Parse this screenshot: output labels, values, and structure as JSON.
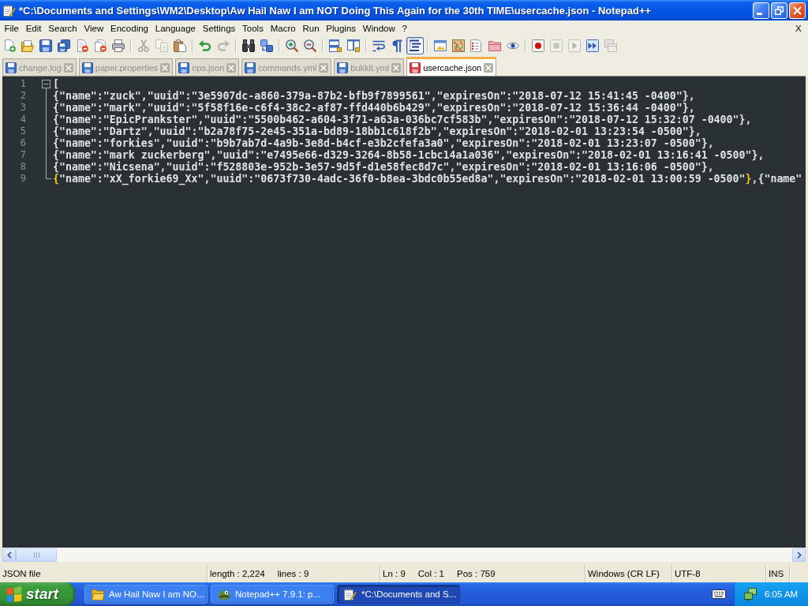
{
  "window": {
    "title": "*C:\\Documents and Settings\\WM2\\Desktop\\Aw Hail Naw I am NOT Doing This Again for the 30th TIME\\usercache.json - Notepad++"
  },
  "menu": {
    "items": [
      "File",
      "Edit",
      "Search",
      "View",
      "Encoding",
      "Language",
      "Settings",
      "Tools",
      "Macro",
      "Run",
      "Plugins",
      "Window",
      "?"
    ],
    "close_label": "X"
  },
  "toolbar": [
    [
      {
        "kind": "new",
        "disabled": false,
        "pressed": false
      },
      {
        "kind": "open",
        "disabled": false,
        "pressed": false
      },
      {
        "kind": "save",
        "disabled": false,
        "pressed": false
      },
      {
        "kind": "saveall",
        "disabled": false,
        "pressed": false
      },
      {
        "kind": "close",
        "disabled": false,
        "pressed": false
      },
      {
        "kind": "closeall",
        "disabled": false,
        "pressed": false
      },
      {
        "kind": "print",
        "disabled": false,
        "pressed": false
      }
    ],
    [
      {
        "kind": "cut",
        "disabled": true,
        "pressed": false
      },
      {
        "kind": "copy",
        "disabled": true,
        "pressed": false
      },
      {
        "kind": "paste",
        "disabled": false,
        "pressed": false
      }
    ],
    [
      {
        "kind": "undo",
        "disabled": false,
        "pressed": false
      },
      {
        "kind": "redo",
        "disabled": true,
        "pressed": false
      }
    ],
    [
      {
        "kind": "find",
        "disabled": false,
        "pressed": false
      },
      {
        "kind": "replace",
        "disabled": false,
        "pressed": false
      }
    ],
    [
      {
        "kind": "zoomin",
        "disabled": false,
        "pressed": false
      },
      {
        "kind": "zoomout",
        "disabled": false,
        "pressed": false
      }
    ],
    [
      {
        "kind": "syncv",
        "disabled": false,
        "pressed": false
      },
      {
        "kind": "synch",
        "disabled": false,
        "pressed": false
      }
    ],
    [
      {
        "kind": "wrap",
        "disabled": false,
        "pressed": false
      },
      {
        "kind": "allchars",
        "disabled": false,
        "pressed": false
      },
      {
        "kind": "indentguide",
        "disabled": false,
        "pressed": true
      }
    ],
    [
      {
        "kind": "udl",
        "disabled": false,
        "pressed": false
      },
      {
        "kind": "docmap",
        "disabled": false,
        "pressed": false
      },
      {
        "kind": "funclist",
        "disabled": false,
        "pressed": false
      },
      {
        "kind": "workspace",
        "disabled": false,
        "pressed": false
      },
      {
        "kind": "monitor",
        "disabled": false,
        "pressed": false
      }
    ],
    [
      {
        "kind": "record",
        "disabled": false,
        "pressed": false
      },
      {
        "kind": "stop",
        "disabled": true,
        "pressed": false
      },
      {
        "kind": "play",
        "disabled": true,
        "pressed": false
      },
      {
        "kind": "playmulti",
        "disabled": false,
        "pressed": false
      },
      {
        "kind": "savemacro",
        "disabled": true,
        "pressed": false
      }
    ]
  ],
  "tabs": [
    {
      "label": "change.log",
      "selected": false,
      "modified": false
    },
    {
      "label": "paper.properties",
      "selected": false,
      "modified": false
    },
    {
      "label": "ops.json",
      "selected": false,
      "modified": false
    },
    {
      "label": "commands.yml",
      "selected": false,
      "modified": false
    },
    {
      "label": "bukkit.yml",
      "selected": false,
      "modified": false
    },
    {
      "label": "usercache.json",
      "selected": true,
      "modified": true
    }
  ],
  "editor": {
    "fold": {
      "expanded": true
    },
    "lines": [
      {
        "number": "1",
        "segments": [
          {
            "text": "[",
            "highlighted": false
          }
        ]
      },
      {
        "number": "2",
        "segments": [
          {
            "text": "{\"name\":\"zuck\",\"uuid\":\"3e5907dc-a860-379a-87b2-bfb9f7899561\",\"expiresOn\":\"2018-07-12 15:41:45 -0400\"},",
            "highlighted": false
          }
        ]
      },
      {
        "number": "3",
        "segments": [
          {
            "text": "{\"name\":\"mark\",\"uuid\":\"5f58f16e-c6f4-38c2-af87-ffd440b6b429\",\"expiresOn\":\"2018-07-12 15:36:44 -0400\"},",
            "highlighted": false
          }
        ]
      },
      {
        "number": "4",
        "segments": [
          {
            "text": "{\"name\":\"EpicPrankster\",\"uuid\":\"5500b462-a604-3f71-a63a-036bc7cf583b\",\"expiresOn\":\"2018-07-12 15:32:07 -0400\"},",
            "highlighted": false
          }
        ]
      },
      {
        "number": "5",
        "segments": [
          {
            "text": "{\"name\":\"Dartz\",\"uuid\":\"b2a78f75-2e45-351a-bd89-18bb1c618f2b\",\"expiresOn\":\"2018-02-01 13:23:54 -0500\"},",
            "highlighted": false
          }
        ]
      },
      {
        "number": "6",
        "segments": [
          {
            "text": "{\"name\":\"forkies\",\"uuid\":\"b9b7ab7d-4a9b-3e8d-b4cf-e3b2cfefa3a0\",\"expiresOn\":\"2018-02-01 13:23:07 -0500\"},",
            "highlighted": false
          }
        ]
      },
      {
        "number": "7",
        "segments": [
          {
            "text": "{\"name\":\"mark zuckerberg\",\"uuid\":\"e7495e66-d329-3264-8b58-1cbc14a1a036\",\"expiresOn\":\"2018-02-01 13:16:41 -0500\"},",
            "highlighted": false
          }
        ]
      },
      {
        "number": "8",
        "segments": [
          {
            "text": "{\"name\":\"Nicsena\",\"uuid\":\"f528803e-952b-3e57-9d5f-d1e58fec8d7c\",\"expiresOn\":\"2018-02-01 13:16:06 -0500\"},",
            "highlighted": false
          }
        ]
      },
      {
        "number": "9",
        "segments": [
          {
            "text": "{",
            "highlighted": true
          },
          {
            "text": "\"name\":\"xX_forkie69_Xx\",\"uuid\":\"0673f730-4adc-36f0-b8ea-3bdc0b55ed8a\",\"expiresOn\":\"2018-02-01 13:00:59 -0500\"",
            "highlighted": false
          },
          {
            "text": "}",
            "highlighted": true
          },
          {
            "text": ",{\"name\"",
            "highlighted": false
          }
        ]
      }
    ]
  },
  "status_bar": {
    "sections": [
      [
        "JSON file"
      ],
      [
        "length : 2,224",
        "lines : 9"
      ],
      [
        "Ln : 9",
        "Col : 1",
        "Pos : 759"
      ],
      [
        "Windows (CR LF)"
      ],
      [
        "UTF-8"
      ],
      [
        "INS"
      ]
    ]
  },
  "taskbar": {
    "start_label": "start",
    "tasks": [
      {
        "label": "Aw Hail Naw I am NO...",
        "kind": "folder",
        "selected": false
      },
      {
        "label": "Notepad++ 7.9.1: p...",
        "kind": "app",
        "selected": false
      },
      {
        "label": "*C:\\Documents and S...",
        "kind": "notepad",
        "selected": true
      }
    ],
    "clock": "6:05 AM"
  }
}
